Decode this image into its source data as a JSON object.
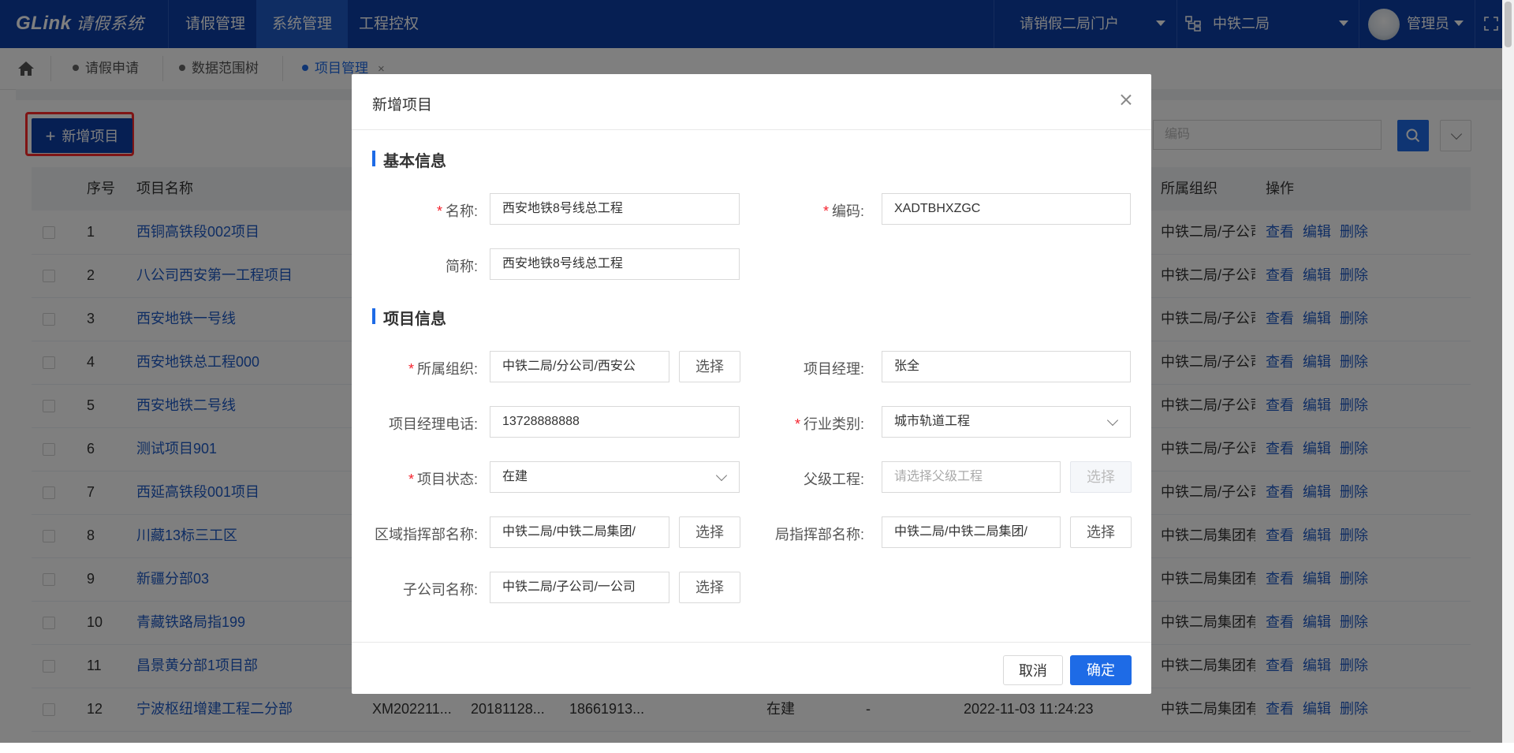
{
  "app": {
    "logo": "GLink",
    "logo_sub": "请假系统"
  },
  "nav": [
    {
      "label": "请假管理"
    },
    {
      "label": "系统管理"
    },
    {
      "label": "工程控权"
    }
  ],
  "portal": "请销假二局门户",
  "org": "中铁二局",
  "user": "管理员",
  "tabs": [
    {
      "label": "请假申请"
    },
    {
      "label": "数据范围树"
    },
    {
      "label": "项目管理"
    }
  ],
  "toolbar": {
    "add_label": "新增项目",
    "search_placeholder": "编码"
  },
  "table": {
    "headers": {
      "index": "序号",
      "name": "项目名称",
      "org": "所属组织",
      "actions": "操作"
    },
    "action_view": "查看",
    "action_edit": "编辑",
    "action_delete": "删除",
    "rows": [
      {
        "index": "1",
        "name": "西铜高铁段002项目",
        "org": "中铁二局/子公司"
      },
      {
        "index": "2",
        "name": "八公司西安第一工程项目",
        "org": "中铁二局/子公司"
      },
      {
        "index": "3",
        "name": "西安地铁一号线",
        "org": "中铁二局/子公司"
      },
      {
        "index": "4",
        "name": "西安地铁总工程000",
        "org": "中铁二局/子公司"
      },
      {
        "index": "5",
        "name": "西安地铁二号线",
        "org": "中铁二局/子公司"
      },
      {
        "index": "6",
        "name": "测试项目901",
        "org": "中铁二局/子公司"
      },
      {
        "index": "7",
        "name": "西延高铁段001项目",
        "org": "中铁二局/子公司"
      },
      {
        "index": "8",
        "name": "川藏13标三工区",
        "org": "中铁二局集团有"
      },
      {
        "index": "9",
        "name": "新疆分部03",
        "org": "中铁二局集团有"
      },
      {
        "index": "10",
        "name": "青藏铁路局指199",
        "org": "中铁二局集团有"
      },
      {
        "index": "11",
        "name": "昌景黄分部1项目部",
        "org": "中铁二局集团有"
      },
      {
        "index": "12",
        "name": "宁波枢纽增建工程二分部",
        "org": "中铁二局集团有",
        "code": "XM202211...",
        "c2": "20181128...",
        "c3": "18661913...",
        "status": "在建",
        "c5": "-",
        "time": "2022-11-03 11:24:23"
      }
    ]
  },
  "modal": {
    "title": "新增项目",
    "sections": {
      "basic": "基本信息",
      "project": "项目信息"
    },
    "fields": {
      "name": {
        "label": "名称:",
        "value": "西安地铁8号线总工程"
      },
      "code": {
        "label": "编码:",
        "value": "XADTBHXZGC"
      },
      "short": {
        "label": "简称:",
        "value": "西安地铁8号线总工程"
      },
      "org": {
        "label": "所属组织:",
        "value": "中铁二局/分公司/西安公"
      },
      "manager": {
        "label": "项目经理:",
        "value": "张全"
      },
      "phone": {
        "label": "项目经理电话:",
        "value": "13728888888"
      },
      "industry": {
        "label": "行业类别:",
        "value": "城市轨道工程"
      },
      "status": {
        "label": "项目状态:",
        "value": "在建"
      },
      "parent": {
        "label": "父级工程:",
        "placeholder": "请选择父级工程"
      },
      "region": {
        "label": "区域指挥部名称:",
        "value": "中铁二局/中铁二局集团/"
      },
      "bureau": {
        "label": "局指挥部名称:",
        "value": "中铁二局/中铁二局集团/"
      },
      "sub": {
        "label": "子公司名称:",
        "value": "中铁二局/子公司/一公司"
      }
    },
    "pick_label": "选择",
    "cancel_label": "取消",
    "ok_label": "确定"
  },
  "colors": {
    "topbar": "#0d3fa6",
    "accent": "#1e6be6",
    "highlight_box": "#ff2a2a",
    "required": "#f5222d"
  }
}
